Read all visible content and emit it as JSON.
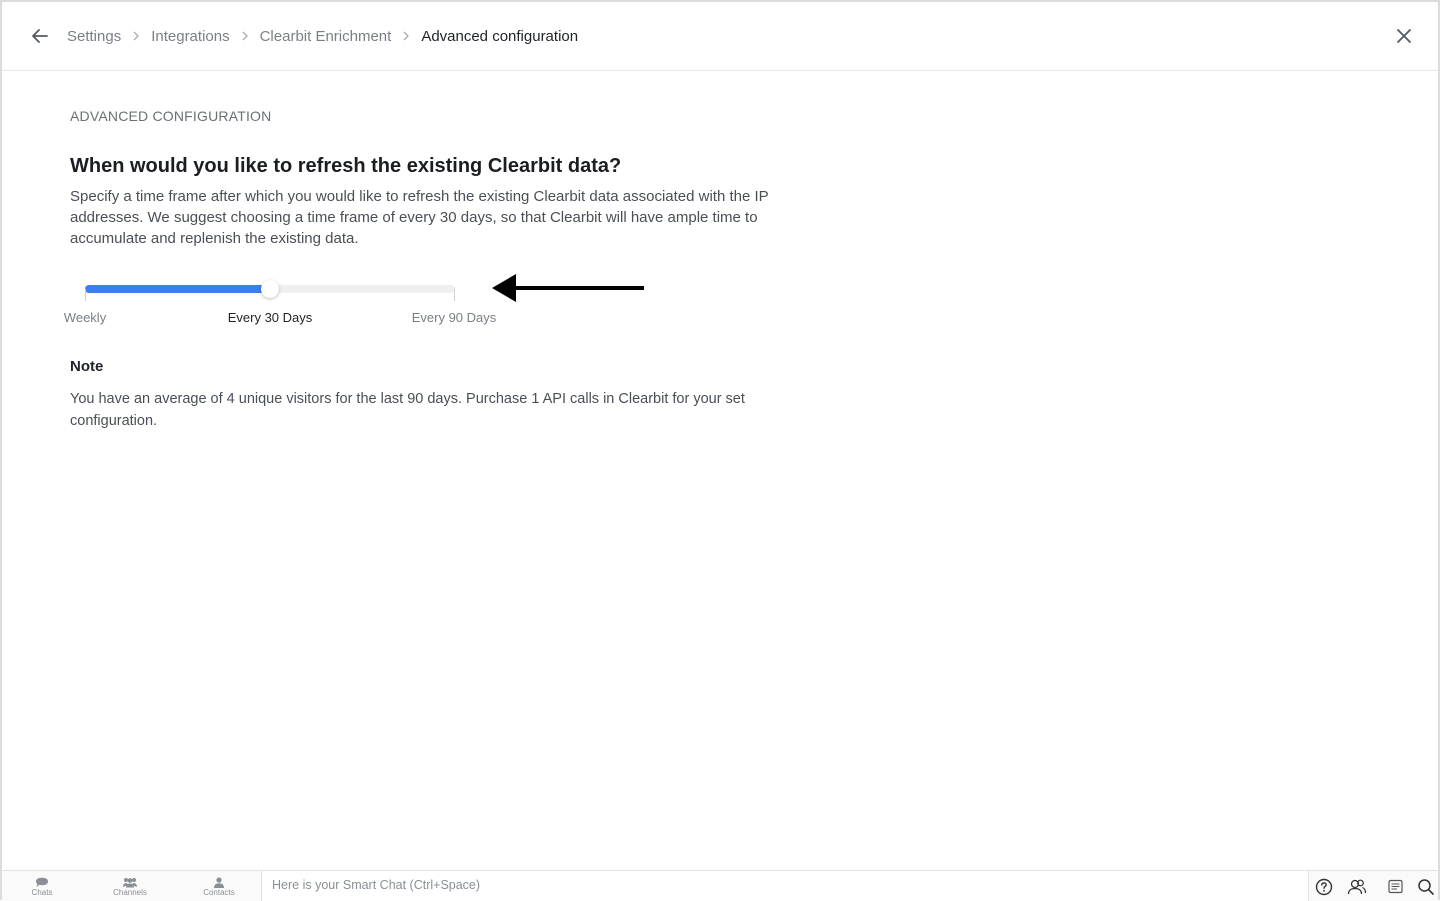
{
  "header": {
    "breadcrumb": [
      "Settings",
      "Integrations",
      "Clearbit Enrichment",
      "Advanced configuration"
    ]
  },
  "content": {
    "section_label": "ADVANCED CONFIGURATION",
    "question": "When would you like to refresh the existing Clearbit data?",
    "description": "Specify a time frame after which you would like to refresh the existing Clearbit data associated with the IP addresses. We suggest choosing a time frame of every 30 days, so that Clearbit will have ample time to accumulate and replenish the existing data.",
    "slider": {
      "stops": [
        "Weekly",
        "Every 30 Days",
        "Every 90 Days"
      ],
      "selected": "Every 30 Days",
      "selected_fraction": 0.5,
      "accent": "#3a7ef0"
    },
    "note_title": "Note",
    "note_text": "You have an average of 4 unique visitors for the last 90 days. Purchase 1 API calls in Clearbit for your set configuration."
  },
  "bottom_bar": {
    "nav": [
      {
        "label": "Chats",
        "icon": "chats-icon"
      },
      {
        "label": "Channels",
        "icon": "channels-icon"
      },
      {
        "label": "Contacts",
        "icon": "contacts-icon"
      }
    ],
    "smart_chat_placeholder": "Here is your Smart Chat (Ctrl+Space)",
    "tools": [
      "help-icon",
      "visitors-icon",
      "notes-icon",
      "search-icon"
    ]
  }
}
